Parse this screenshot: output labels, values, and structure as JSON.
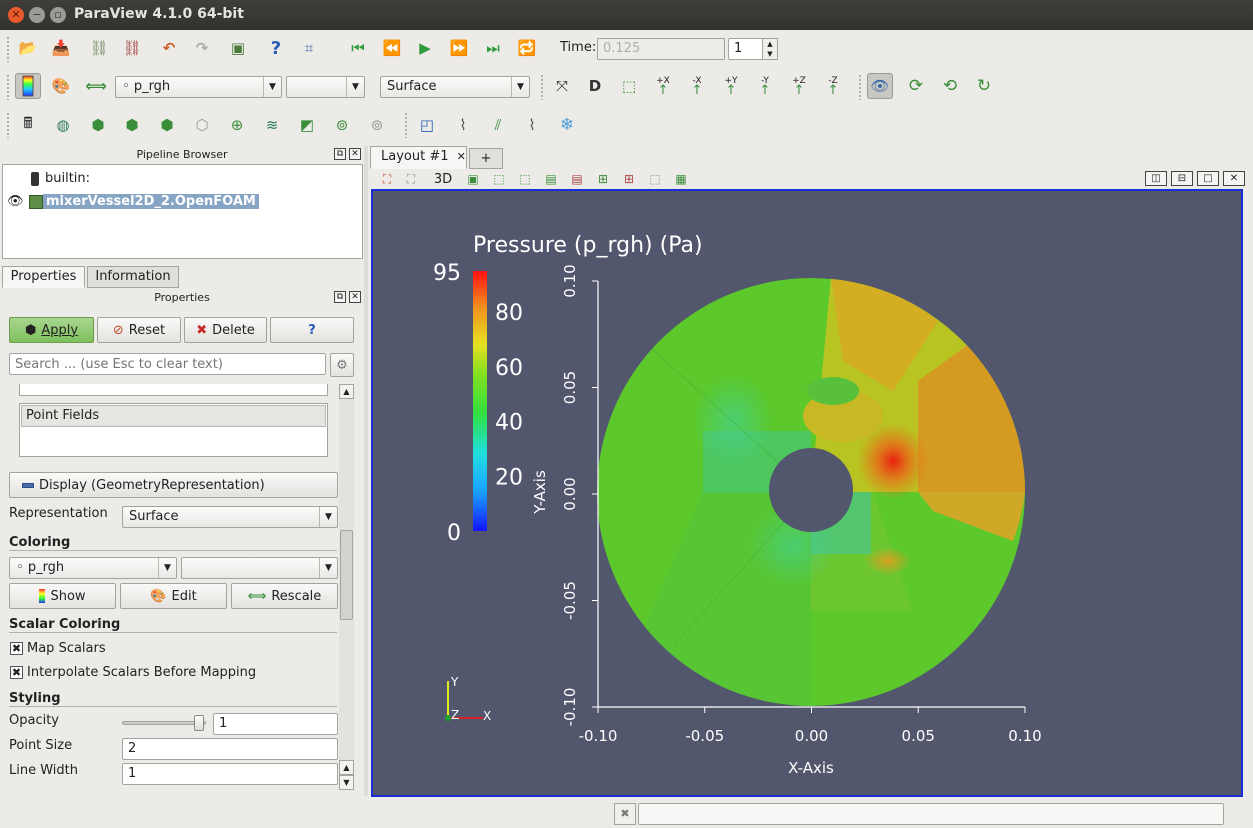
{
  "window": {
    "title": "ParaView 4.1.0 64-bit"
  },
  "toolbar1": {
    "time_label": "Time:",
    "time_value": "0.125",
    "timestep_value": "1"
  },
  "toolbar2": {
    "color_array": "p_rgh",
    "color_component": "",
    "representation": "Surface"
  },
  "toolbar2_labels": {
    "neg_x": "-X",
    "pos_x": "+X",
    "neg_y": "-Y",
    "pos_y": "+Y",
    "neg_z": "-Z",
    "pos_z": "+Z"
  },
  "pipeline_browser": {
    "title": "Pipeline Browser",
    "items": [
      {
        "label": "builtin:"
      },
      {
        "label": "mixerVessel2D_2.OpenFOAM"
      }
    ]
  },
  "tabs": {
    "properties": "Properties",
    "information": "Information"
  },
  "properties_panel": {
    "title": "Properties",
    "apply_label": "Apply",
    "reset_label": "Reset",
    "delete_label": "Delete",
    "help_label": "?",
    "search_placeholder": "Search ... (use Esc to clear text)",
    "point_fields_label": "Point Fields",
    "display_label": "Display (GeometryRepresentation)",
    "representation_label": "Representation",
    "representation_value": "Surface",
    "coloring_heading": "Coloring",
    "coloring_array": "p_rgh",
    "coloring_component": "",
    "show_label": "Show",
    "edit_label": "Edit",
    "rescale_label": "Rescale",
    "scalar_coloring_heading": "Scalar Coloring",
    "map_scalars_label": "Map Scalars",
    "interpolate_label": "Interpolate Scalars Before Mapping",
    "styling_heading": "Styling",
    "opacity_label": "Opacity",
    "opacity_value": "1",
    "point_size_label": "Point Size",
    "point_size_value": "2",
    "line_width_label": "Line Width",
    "line_width_value": "1"
  },
  "layout_tabs": {
    "layout1": "Layout #1",
    "add": "+"
  },
  "view_toolbar": {
    "mode_3d": "3D"
  },
  "render_view": {
    "bg_color": "#52576e",
    "colorbar": {
      "title": "Pressure (p_rgh) (Pa)",
      "max_label": "95",
      "min_label": "0",
      "ticks": [
        "80",
        "60",
        "40",
        "20"
      ]
    },
    "axes": {
      "x_label": "X-Axis",
      "y_label": "Y-Axis",
      "x_ticks": [
        "-0.10",
        "-0.05",
        "0.00",
        "0.05",
        "0.10"
      ],
      "y_ticks": [
        "0.10",
        "0.05",
        "0.00",
        "-0.05",
        "-0.10"
      ]
    },
    "orientation_axes": {
      "x": "X",
      "y": "Y",
      "z": "Z"
    }
  }
}
